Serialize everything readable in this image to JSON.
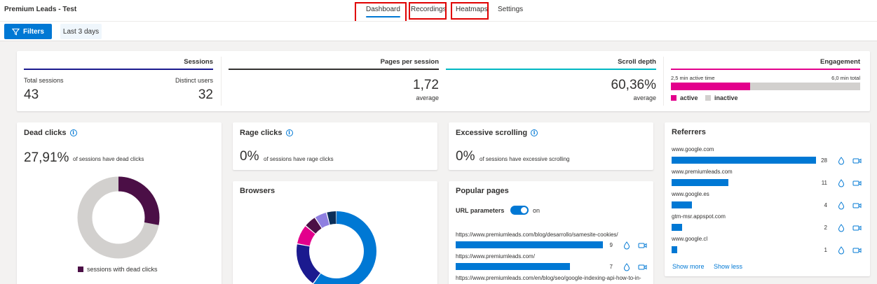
{
  "header": {
    "project": "Premium Leads - Test",
    "tabs": [
      {
        "label": "Dashboard",
        "active": true
      },
      {
        "label": "Recordings",
        "active": false
      },
      {
        "label": "Heatmaps",
        "active": false
      },
      {
        "label": "Settings",
        "active": false
      }
    ]
  },
  "filterbar": {
    "filters_label": "Filters",
    "range_label": "Last 3 days"
  },
  "colors": {
    "accent": "#0078d4",
    "sessions": "#1b1a8f",
    "pages": "#323130",
    "scroll": "#00b7c3",
    "engagement": "#e3008c",
    "dead": "#4b0f46",
    "inactive": "#d2d0ce",
    "highlight": "#e00000"
  },
  "summary": {
    "sessions": {
      "title": "Sessions",
      "total_label": "Total sessions",
      "total": "43",
      "distinct_label": "Distinct users",
      "distinct": "32"
    },
    "pages": {
      "title": "Pages per session",
      "value": "1,72",
      "sub": "average"
    },
    "scroll": {
      "title": "Scroll depth",
      "value": "60,36%",
      "sub": "average"
    },
    "engagement": {
      "title": "Engagement",
      "active_label": "2,5 min active time",
      "total_label": "6,0 min total",
      "active_fraction": 0.4167,
      "legend_active": "active",
      "legend_inactive": "inactive"
    }
  },
  "dead_clicks": {
    "title": "Dead clicks",
    "value": "27,91%",
    "note": "of sessions have dead clicks",
    "fraction": 0.2791,
    "legend": "sessions with dead clicks"
  },
  "rage_clicks": {
    "title": "Rage clicks",
    "value": "0%",
    "note": "of sessions have rage clicks"
  },
  "excessive_scrolling": {
    "title": "Excessive scrolling",
    "value": "0%",
    "note": "of sessions have excessive scrolling"
  },
  "browsers": {
    "title": "Browsers",
    "slices": [
      {
        "fraction": 0.6,
        "color": "#0078d4"
      },
      {
        "fraction": 0.18,
        "color": "#1b1a8f"
      },
      {
        "fraction": 0.08,
        "color": "#e3008c"
      },
      {
        "fraction": 0.05,
        "color": "#4b0f46"
      },
      {
        "fraction": 0.05,
        "color": "#8f7fe0"
      },
      {
        "fraction": 0.04,
        "color": "#0b2e59"
      }
    ]
  },
  "popular_pages": {
    "title": "Popular pages",
    "url_params_label": "URL parameters",
    "toggle_state": "on",
    "max": 9,
    "pages": [
      {
        "url": "https://www.premiumleads.com/blog/desarrollo/samesite-cookies/",
        "count": 9
      },
      {
        "url": "https://www.premiumleads.com/",
        "count": 7
      },
      {
        "url": "https://www.premiumleads.com/en/blog/seo/google-indexing-api-how-to-in-",
        "count": null
      }
    ]
  },
  "referrers": {
    "title": "Referrers",
    "max": 28,
    "items": [
      {
        "domain": "www.google.com",
        "count": 28
      },
      {
        "domain": "www.premiumleads.com",
        "count": 11
      },
      {
        "domain": "www.google.es",
        "count": 4
      },
      {
        "domain": "gtm-msr.appspot.com",
        "count": 2
      },
      {
        "domain": "www.google.cl",
        "count": 1
      }
    ],
    "show_more": "Show more",
    "show_less": "Show less"
  }
}
